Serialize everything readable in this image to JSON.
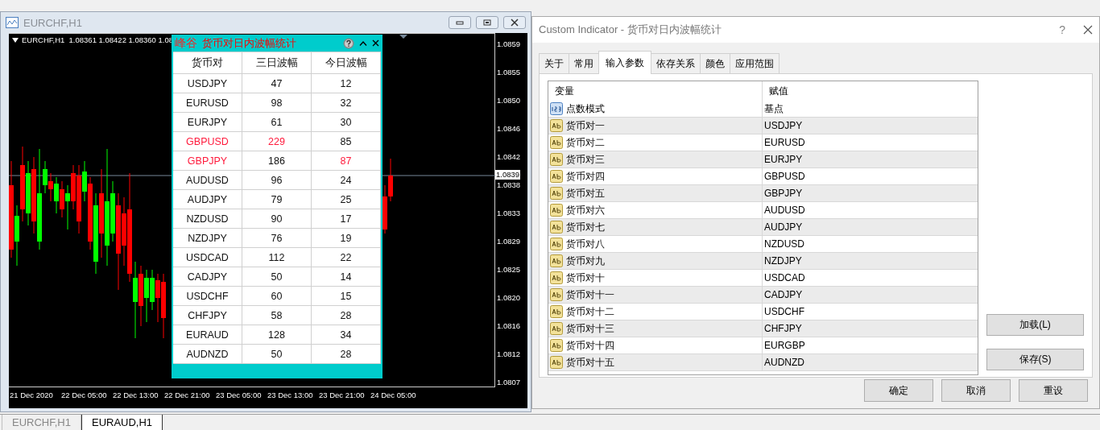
{
  "chart_window": {
    "title": "EURCHF,H1",
    "header": "EURCHF,H1  1.08361 1.08422 1.08360 1.08",
    "price_labels": [
      "1.0859",
      "1.0855",
      "1.0850",
      "1.0846",
      "1.0842",
      "1.0838",
      "1.0833",
      "1.0829",
      "1.0825",
      "1.0820",
      "1.0816",
      "1.0812",
      "1.0807"
    ],
    "current_price": "1.0839",
    "time_labels": [
      "21 Dec 2020",
      "22 Dec 05:00",
      "22 Dec 13:00",
      "22 Dec 21:00",
      "23 Dec 05:00",
      "23 Dec 13:00",
      "23 Dec 21:00",
      "24 Dec 05:00"
    ]
  },
  "indicator_panel": {
    "logo": "峰谷",
    "title": "货币对日内波幅统计",
    "columns": [
      "货币对",
      "三日波幅",
      "今日波幅"
    ],
    "rows": [
      {
        "cells": [
          {
            "text": "USDJPY",
            "alert": false
          },
          {
            "text": "47",
            "alert": false
          },
          {
            "text": "12",
            "alert": false
          }
        ]
      },
      {
        "cells": [
          {
            "text": "EURUSD",
            "alert": false
          },
          {
            "text": "98",
            "alert": false
          },
          {
            "text": "32",
            "alert": false
          }
        ]
      },
      {
        "cells": [
          {
            "text": "EURJPY",
            "alert": false
          },
          {
            "text": "61",
            "alert": false
          },
          {
            "text": "30",
            "alert": false
          }
        ]
      },
      {
        "cells": [
          {
            "text": "GBPUSD",
            "alert": true
          },
          {
            "text": "229",
            "alert": true
          },
          {
            "text": "85",
            "alert": false
          }
        ]
      },
      {
        "cells": [
          {
            "text": "GBPJPY",
            "alert": true
          },
          {
            "text": "186",
            "alert": false
          },
          {
            "text": "87",
            "alert": true
          }
        ]
      },
      {
        "cells": [
          {
            "text": "AUDUSD",
            "alert": false
          },
          {
            "text": "96",
            "alert": false
          },
          {
            "text": "24",
            "alert": false
          }
        ]
      },
      {
        "cells": [
          {
            "text": "AUDJPY",
            "alert": false
          },
          {
            "text": "79",
            "alert": false
          },
          {
            "text": "25",
            "alert": false
          }
        ]
      },
      {
        "cells": [
          {
            "text": "NZDUSD",
            "alert": false
          },
          {
            "text": "90",
            "alert": false
          },
          {
            "text": "17",
            "alert": false
          }
        ]
      },
      {
        "cells": [
          {
            "text": "NZDJPY",
            "alert": false
          },
          {
            "text": "76",
            "alert": false
          },
          {
            "text": "19",
            "alert": false
          }
        ]
      },
      {
        "cells": [
          {
            "text": "USDCAD",
            "alert": false
          },
          {
            "text": "112",
            "alert": false
          },
          {
            "text": "22",
            "alert": false
          }
        ]
      },
      {
        "cells": [
          {
            "text": "CADJPY",
            "alert": false
          },
          {
            "text": "50",
            "alert": false
          },
          {
            "text": "14",
            "alert": false
          }
        ]
      },
      {
        "cells": [
          {
            "text": "USDCHF",
            "alert": false
          },
          {
            "text": "60",
            "alert": false
          },
          {
            "text": "15",
            "alert": false
          }
        ]
      },
      {
        "cells": [
          {
            "text": "CHFJPY",
            "alert": false
          },
          {
            "text": "58",
            "alert": false
          },
          {
            "text": "28",
            "alert": false
          }
        ]
      },
      {
        "cells": [
          {
            "text": "EURAUD",
            "alert": false
          },
          {
            "text": "128",
            "alert": false
          },
          {
            "text": "34",
            "alert": false
          }
        ]
      },
      {
        "cells": [
          {
            "text": "AUDNZD",
            "alert": false
          },
          {
            "text": "50",
            "alert": false
          },
          {
            "text": "28",
            "alert": false
          }
        ]
      }
    ]
  },
  "dialog": {
    "title": "Custom Indicator - 货币对日内波幅统计",
    "help": "?",
    "tabs": [
      {
        "label": "关于",
        "selected": false
      },
      {
        "label": "常用",
        "selected": false
      },
      {
        "label": "输入参数",
        "selected": true
      },
      {
        "label": "依存关系",
        "selected": false
      },
      {
        "label": "颜色",
        "selected": false
      },
      {
        "label": "应用范围",
        "selected": false
      }
    ],
    "table": {
      "columns": [
        "变量",
        "赋值"
      ],
      "rows": [
        {
          "kind": "number",
          "name": "点数模式",
          "value": "基点"
        },
        {
          "kind": "text",
          "name": "货币对一",
          "value": "USDJPY"
        },
        {
          "kind": "text",
          "name": "货币对二",
          "value": "EURUSD"
        },
        {
          "kind": "text",
          "name": "货币对三",
          "value": "EURJPY"
        },
        {
          "kind": "text",
          "name": "货币对四",
          "value": "GBPUSD"
        },
        {
          "kind": "text",
          "name": "货币对五",
          "value": "GBPJPY"
        },
        {
          "kind": "text",
          "name": "货币对六",
          "value": "AUDUSD"
        },
        {
          "kind": "text",
          "name": "货币对七",
          "value": "AUDJPY"
        },
        {
          "kind": "text",
          "name": "货币对八",
          "value": "NZDUSD"
        },
        {
          "kind": "text",
          "name": "货币对九",
          "value": "NZDJPY"
        },
        {
          "kind": "text",
          "name": "货币对十",
          "value": "USDCAD"
        },
        {
          "kind": "text",
          "name": "货币对十一",
          "value": "CADJPY"
        },
        {
          "kind": "text",
          "name": "货币对十二",
          "value": "USDCHF"
        },
        {
          "kind": "text",
          "name": "货币对十三",
          "value": "CHFJPY"
        },
        {
          "kind": "text",
          "name": "货币对十四",
          "value": "EURGBP"
        },
        {
          "kind": "text",
          "name": "货币对十五",
          "value": "AUDNZD"
        }
      ]
    },
    "side_buttons": [
      "加载(L)",
      "保存(S)"
    ],
    "buttons": [
      "确定",
      "取消",
      "重设"
    ]
  },
  "chart_tabs": [
    {
      "label": "EURCHF,H1",
      "selected": false
    },
    {
      "label": "EURAUD,H1",
      "selected": true
    }
  ]
}
